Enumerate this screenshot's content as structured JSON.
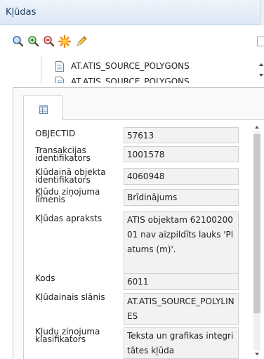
{
  "window": {
    "title": "Kļūdas"
  },
  "toolbar": {
    "icons": [
      "zoom-icon",
      "zoom-in-icon",
      "zoom-out-icon",
      "highlight-icon",
      "edit-icon"
    ]
  },
  "layers": {
    "items": [
      "AT.ATIS_SOURCE_POLYGONS",
      "AT.ATIS_SOURCE_POLYGONS"
    ]
  },
  "attributes": [
    {
      "label": "OBJECTID",
      "value": "57613"
    },
    {
      "label": "Transakcijas identifikators",
      "value": "1001578"
    },
    {
      "label": "Kļūdainā objekta identifikators",
      "value": "4060948"
    },
    {
      "label": "Kļūdu ziņojuma līmenis",
      "value": "Brīdinājums"
    },
    {
      "label": "Kļūdas apraksts",
      "value": "ATIS objektam 6210020001 nav aizpildīts lauks 'Platums (m)'."
    },
    {
      "label": "Kods",
      "value": "6011"
    },
    {
      "label": "Kļūdainais slānis",
      "value": "AT.ATIS_SOURCE_POLYLINES"
    },
    {
      "label": "Kļudu ziņojuma klasifikators",
      "value": "Teksta un grafikas integritātes kļūda"
    }
  ]
}
